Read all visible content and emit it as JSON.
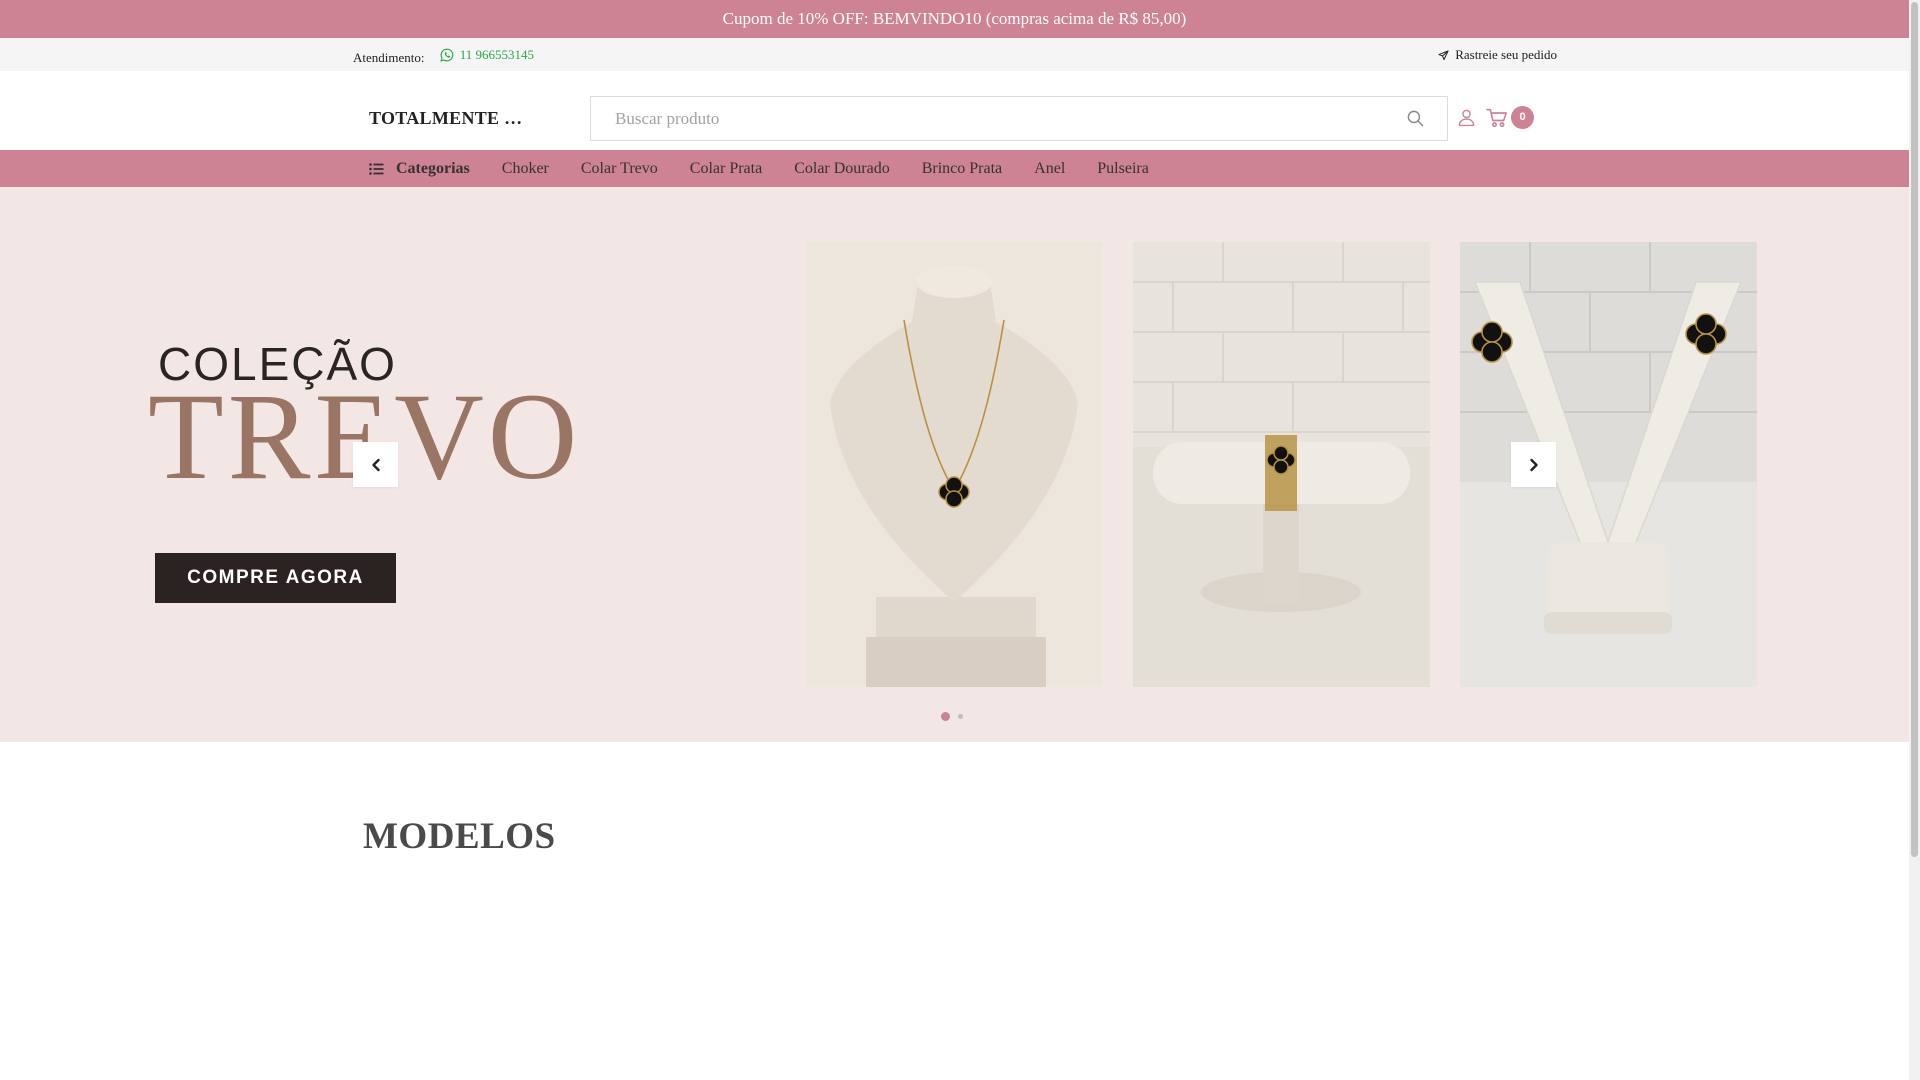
{
  "promo_bar": {
    "text": "Cupom de 10% OFF: BEMVINDO10 (compras acima de R$ 85,00)"
  },
  "info_bar": {
    "attendance_label": "Atendimento:",
    "phone": "11 966553145",
    "track_label": "Rastreie seu pedido"
  },
  "header": {
    "brand": "TOTALMENTE …",
    "search_placeholder": "Buscar produto",
    "cart_count": "0"
  },
  "nav": {
    "categories_label": "Categorias",
    "items": [
      "Choker",
      "Colar Trevo",
      "Colar Prata",
      "Colar Dourado",
      "Brinco Prata",
      "Anel",
      "Pulseira"
    ]
  },
  "hero": {
    "subtitle": "COLEÇÃO",
    "title": "TREVO",
    "cta_label": "COMPRE AGORA",
    "slide_count": 2,
    "active_slide": 1
  },
  "section": {
    "title": "MODELOS"
  },
  "colors": {
    "accent": "#cd8393",
    "hero_bg": "#f2e7e5",
    "whatsapp_green": "#2aa843",
    "cta_bg": "#2b2222",
    "title_brown": "#9b7563"
  },
  "icons": [
    "whatsapp-icon",
    "send-icon",
    "search-icon",
    "user-icon",
    "cart-icon",
    "menu-icon",
    "chevron-left-icon",
    "chevron-right-icon"
  ]
}
